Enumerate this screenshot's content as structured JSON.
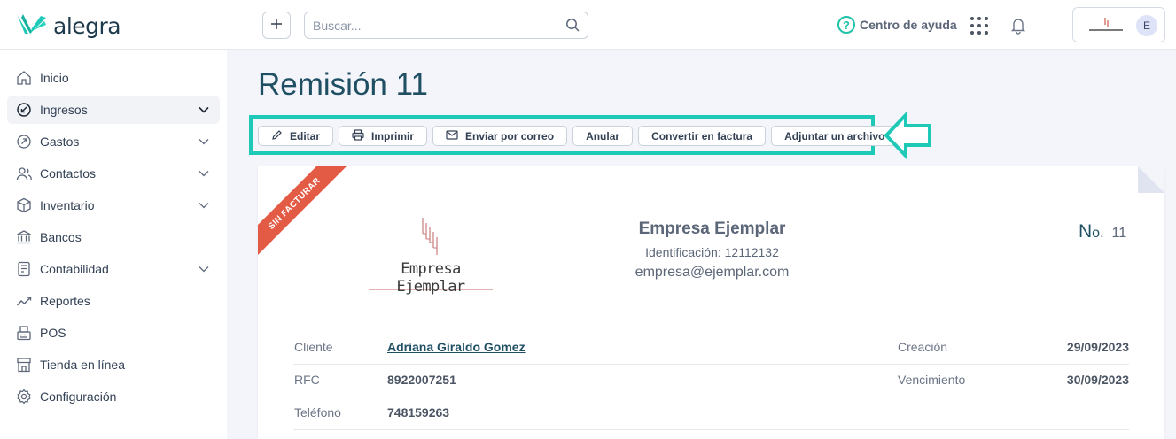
{
  "app": {
    "logo_text": "alegra",
    "search_placeholder": "Buscar...",
    "help_label": "Centro de ayuda",
    "avatar_initial": "E",
    "brand_color": "#1ec9b7"
  },
  "sidebar": {
    "items": [
      {
        "label": "Inicio",
        "icon": "home-icon"
      },
      {
        "label": "Ingresos",
        "icon": "income-icon"
      },
      {
        "label": "Gastos",
        "icon": "expenses-icon"
      },
      {
        "label": "Contactos",
        "icon": "contacts-icon"
      },
      {
        "label": "Inventario",
        "icon": "inventory-icon"
      },
      {
        "label": "Bancos",
        "icon": "bank-icon"
      },
      {
        "label": "Contabilidad",
        "icon": "accounting-icon"
      },
      {
        "label": "Reportes",
        "icon": "reports-icon"
      },
      {
        "label": "POS",
        "icon": "pos-icon"
      },
      {
        "label": "Tienda en línea",
        "icon": "store-icon"
      },
      {
        "label": "Configuración",
        "icon": "settings-icon"
      }
    ]
  },
  "page": {
    "title": "Remisión 11"
  },
  "toolbar": {
    "edit": "Editar",
    "print": "Imprimir",
    "email": "Enviar por correo",
    "void": "Anular",
    "convert": "Convertir en factura",
    "attach": "Adjuntar un archivo"
  },
  "document": {
    "ribbon": "SIN FACTURAR",
    "logo_text": "Empresa Ejemplar",
    "company_name": "Empresa Ejemplar",
    "identification": "Identificación: 12112132",
    "email": "empresa@ejemplar.com",
    "number_label_big": "N",
    "number_label_small": "o.",
    "number_value": "11",
    "fields": {
      "client_label": "Cliente",
      "client_value": "Adriana Giraldo Gomez",
      "rfc_label": "RFC",
      "rfc_value": "8922007251",
      "phone_label": "Teléfono",
      "phone_value": "748159263",
      "created_label": "Creación",
      "created_value": "29/09/2023",
      "due_label": "Vencimiento",
      "due_value": "30/09/2023"
    }
  }
}
